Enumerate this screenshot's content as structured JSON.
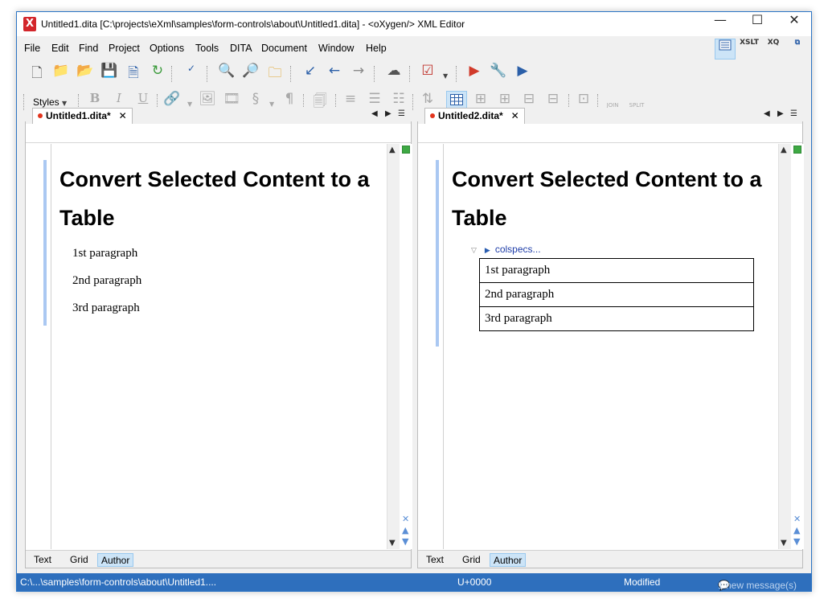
{
  "window": {
    "title": "Untitled1.dita [C:\\projects\\eXml\\samples\\form-controls\\about\\Untitled1.dita] - <oXygen/> XML Editor",
    "minimize": "—",
    "maximize": "☐",
    "close": "✕"
  },
  "menu": {
    "items": [
      "File",
      "Edit",
      "Find",
      "Project",
      "Options",
      "Tools",
      "DITA",
      "Document",
      "Window",
      "Help"
    ]
  },
  "perspectives": {
    "xslt_label": "XSLT",
    "xq_label": "XQ"
  },
  "toolbar": {
    "styles_label": "Styles",
    "bold": "B",
    "italic": "I",
    "underline": "U",
    "section": "§",
    "pilcrow": "¶",
    "join_label": "JOIN",
    "split_label": "SPLIT"
  },
  "left_pane": {
    "tab_label": "Untitled1.dita*",
    "title": "Convert Selected Content to a Table",
    "paragraphs": [
      "1st paragraph",
      "2nd paragraph",
      "3rd paragraph"
    ],
    "modes": [
      "Text",
      "Grid",
      "Author"
    ],
    "active_mode": "Author"
  },
  "right_pane": {
    "tab_label": "Untitled2.dita*",
    "title": "Convert Selected Content to a Table",
    "colspecs_label": "colspecs...",
    "rows": [
      "1st paragraph",
      "2nd paragraph",
      "3rd paragraph"
    ],
    "modes": [
      "Text",
      "Grid",
      "Author"
    ],
    "active_mode": "Author"
  },
  "status": {
    "path": "C:\\...\\samples\\form-controls\\about\\Untitled1....",
    "unicode": "U+0000",
    "state": "Modified",
    "messages": "1 new message(s)"
  },
  "colors": {
    "accent": "#2e6fbd",
    "active_bg": "#cce4f7",
    "modified_dot": "#e2341d",
    "ok_marker": "#3ea944"
  }
}
